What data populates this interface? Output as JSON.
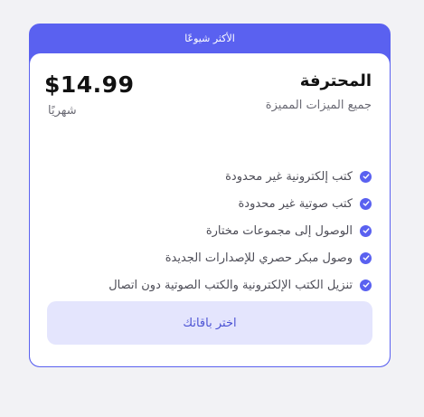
{
  "card": {
    "ribbon": "الأكثر شيوعًا",
    "plan_name": "المحترفة",
    "plan_subtitle": "جميع الميزات المميزة",
    "price": "$14.99",
    "period": "شهريًا",
    "features": [
      {
        "label": "كتب إلكترونية غير محدودة",
        "icon": "check-circle-icon"
      },
      {
        "label": "كتب صوتية غير محدودة",
        "icon": "check-circle-icon"
      },
      {
        "label": "الوصول إلى مجموعات مختارة",
        "icon": "check-circle-icon"
      },
      {
        "label": "وصول مبكر حصري للإصدارات الجديدة",
        "icon": "check-circle-icon"
      },
      {
        "label": "تنزيل الكتب الإلكترونية والكتب الصوتية دون اتصال",
        "icon": "check-circle-icon"
      }
    ],
    "cta_label": "اختر باقاتك"
  },
  "colors": {
    "accent": "#5a61f0",
    "button_bg": "#e4e5fd",
    "button_text": "#4c53d4",
    "page_bg": "#f2f2f5"
  }
}
